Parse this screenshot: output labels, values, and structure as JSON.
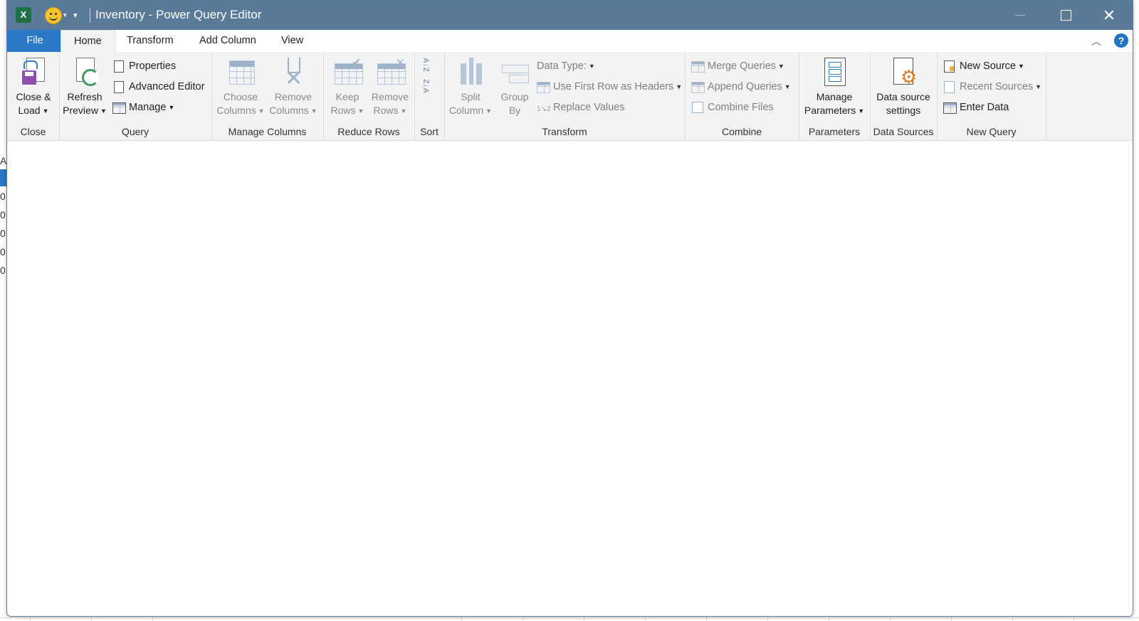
{
  "window": {
    "title": "Inventory - Power Query Editor"
  },
  "titlebar": {
    "app_icon": "excel-logo-icon",
    "app_letter": "X",
    "minimize": "",
    "maximize": "",
    "close": "✕"
  },
  "tabs": [
    {
      "label": "File"
    },
    {
      "label": "Home"
    },
    {
      "label": "Transform"
    },
    {
      "label": "Add Column"
    },
    {
      "label": "View"
    }
  ],
  "help": "?",
  "collapse": "︿",
  "ribbon": {
    "close_group": {
      "label": "Close",
      "close_load": [
        "Close &",
        "Load"
      ]
    },
    "query_group": {
      "label": "Query",
      "refresh": [
        "Refresh",
        "Preview"
      ],
      "properties": "Properties",
      "advanced_editor": "Advanced Editor",
      "manage": "Manage"
    },
    "manage_columns_group": {
      "label": "Manage Columns",
      "choose": [
        "Choose",
        "Columns"
      ],
      "remove": [
        "Remove",
        "Columns"
      ]
    },
    "reduce_rows_group": {
      "label": "Reduce Rows",
      "keep": [
        "Keep",
        "Rows"
      ],
      "remove": [
        "Remove",
        "Rows"
      ]
    },
    "sort_group": {
      "label": "Sort",
      "asc": "A↓Z",
      "desc": "Z↓A"
    },
    "transform_group": {
      "label": "Transform",
      "split": [
        "Split",
        "Column"
      ],
      "group_by": [
        "Group",
        "By"
      ],
      "data_type": "Data Type:",
      "first_row": "Use First Row as Headers",
      "replace": "Replace Values"
    },
    "combine_group": {
      "label": "Combine",
      "merge": "Merge Queries",
      "append": "Append Queries",
      "combine_files": "Combine Files"
    },
    "parameters_group": {
      "label": "Parameters",
      "manage": [
        "Manage",
        "Parameters"
      ]
    },
    "data_sources_group": {
      "label": "Data Sources",
      "settings": [
        "Data source",
        "settings"
      ]
    },
    "new_query_group": {
      "label": "New Query",
      "new_source": "New Source",
      "recent": "Recent Sources",
      "enter": "Enter Data"
    }
  },
  "background_sheet": {
    "left_cells": [
      "A",
      "0",
      "0",
      "0",
      "0",
      "0"
    ]
  }
}
